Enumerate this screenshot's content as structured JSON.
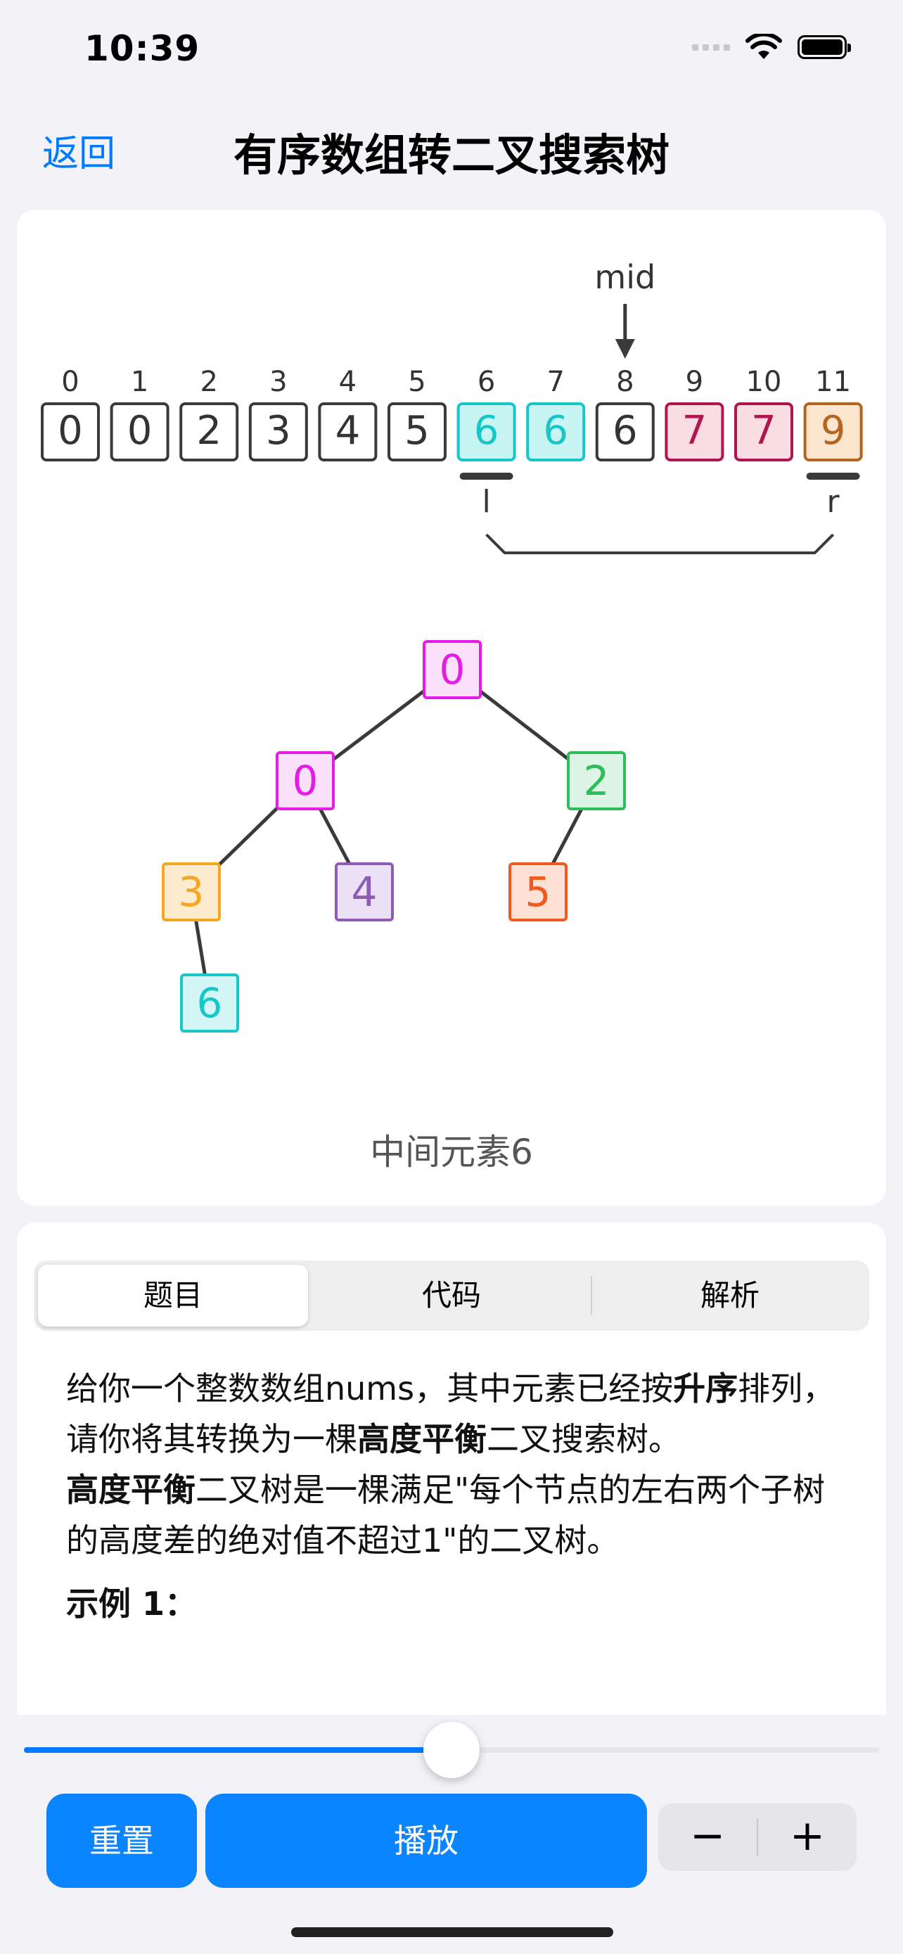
{
  "status": {
    "time": "10:39"
  },
  "nav": {
    "back": "返回",
    "title": "有序数组转二叉搜索树"
  },
  "array_viz": {
    "indices": [
      "0",
      "1",
      "2",
      "3",
      "4",
      "5",
      "6",
      "7",
      "8",
      "9",
      "10",
      "11"
    ],
    "values": [
      "0",
      "0",
      "2",
      "3",
      "4",
      "5",
      "6",
      "6",
      "6",
      "7",
      "7",
      "9"
    ],
    "cell_colors": [
      {
        "stroke": "#3A3A3A",
        "fill": "#FFFFFF"
      },
      {
        "stroke": "#3A3A3A",
        "fill": "#FFFFFF"
      },
      {
        "stroke": "#3A3A3A",
        "fill": "#FFFFFF"
      },
      {
        "stroke": "#3A3A3A",
        "fill": "#FFFFFF"
      },
      {
        "stroke": "#3A3A3A",
        "fill": "#FFFFFF"
      },
      {
        "stroke": "#3A3A3A",
        "fill": "#FFFFFF"
      },
      {
        "stroke": "#17C7C7",
        "fill": "#C9F4F4"
      },
      {
        "stroke": "#17C7C7",
        "fill": "#C9F4F4"
      },
      {
        "stroke": "#3A3A3A",
        "fill": "#FFFFFF"
      },
      {
        "stroke": "#B0154F",
        "fill": "#FADCE3"
      },
      {
        "stroke": "#B0154F",
        "fill": "#FADCE3"
      },
      {
        "stroke": "#B5651D",
        "fill": "#FBE5CF"
      }
    ],
    "mid_label": "mid",
    "mid_index": 8,
    "left_label": "l",
    "left_index": 6,
    "right_label": "r",
    "right_index": 11
  },
  "tree": {
    "nodes": [
      {
        "id": "n0",
        "value": "0",
        "color": "#E61CE6",
        "fill": "#FCE1FC"
      },
      {
        "id": "n1",
        "value": "0",
        "color": "#E61CE6",
        "fill": "#FCE1FC"
      },
      {
        "id": "n2",
        "value": "2",
        "color": "#2DBE5B",
        "fill": "#DCF5E4"
      },
      {
        "id": "n3",
        "value": "3",
        "color": "#F5A623",
        "fill": "#FDEBCD"
      },
      {
        "id": "n4",
        "value": "4",
        "color": "#8E5BB5",
        "fill": "#ECE1F5"
      },
      {
        "id": "n5",
        "value": "5",
        "color": "#F05A1E",
        "fill": "#FDE1D5"
      },
      {
        "id": "n6",
        "value": "6",
        "color": "#17C7C7",
        "fill": "#D5F6F6"
      }
    ],
    "edges": [
      [
        "n0",
        "n1"
      ],
      [
        "n0",
        "n2"
      ],
      [
        "n1",
        "n3"
      ],
      [
        "n1",
        "n4"
      ],
      [
        "n2",
        "n5"
      ],
      [
        "n3",
        "n6"
      ]
    ]
  },
  "caption": "中间元素6",
  "tabs": [
    {
      "label": "题目",
      "active": true
    },
    {
      "label": "代码",
      "active": false
    },
    {
      "label": "解析",
      "active": false
    }
  ],
  "description": {
    "p1_a": "给你一个整数数组nums，其中元素已经按",
    "p1_b": "升序",
    "p1_c": "排列，请你将其转换为一棵",
    "p1_d": "高度平衡",
    "p1_e": "二叉搜索树。",
    "p2_a": "高度平衡",
    "p2_b": "二叉树是一棵满足\"每个节点的左右两个子树的高度差的绝对值不超过1\"的二叉树。",
    "example": "示例 1："
  },
  "progress": {
    "fraction": 0.5
  },
  "controls": {
    "reset": "重置",
    "play": "播放",
    "minus": "−",
    "plus": "+"
  },
  "colors": {
    "accent": "#0A84FF",
    "line": "#3A3A3A"
  }
}
